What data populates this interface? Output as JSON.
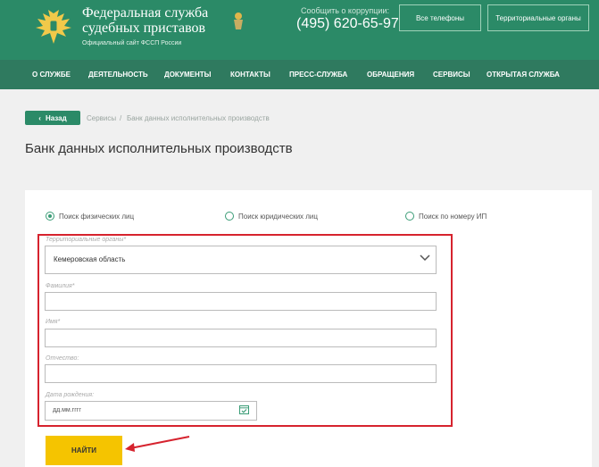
{
  "header": {
    "title": "Федеральная служба судебных приставов",
    "subtitle": "Официальный сайт ФССП России",
    "corruption_label": "Сообщить о коррупции:",
    "phone": "(495) 620-65-97",
    "buttons": [
      "Все телефоны",
      "Территориальные органы"
    ],
    "brand_color": "#2b8a67"
  },
  "nav": {
    "items": [
      "О СЛУЖБЕ",
      "ДЕЯТЕЛЬНОСТЬ",
      "ДОКУМЕНТЫ",
      "КОНТАКТЫ",
      "ПРЕСС-СЛУЖБА",
      "ОБРАЩЕНИЯ",
      "СЕРВИСЫ",
      "ОТКРЫТАЯ СЛУЖБА"
    ]
  },
  "breadcrumb": {
    "back_label": "Назад",
    "items": [
      "Сервисы",
      "/",
      "Банк данных исполнительных производств"
    ]
  },
  "page_title": "Банк данных исполнительных производств",
  "form": {
    "search_modes": [
      {
        "label": "Поиск физических лиц",
        "checked": true
      },
      {
        "label": "Поиск юридических лиц",
        "checked": false
      },
      {
        "label": "Поиск по номеру ИП",
        "checked": false
      }
    ],
    "region_label": "Территориальные органы*",
    "region_value": "Кемеровская область",
    "lastname_label": "Фамилия*",
    "firstname_label": "Имя*",
    "patronymic_label": "Отчество:",
    "birthdate_label": "Дата рождения:",
    "birthdate_placeholder": "дд.мм.гггг",
    "submit_label": "НАЙТИ",
    "highlight_color": "#d6232e",
    "submit_color": "#f5c400"
  }
}
